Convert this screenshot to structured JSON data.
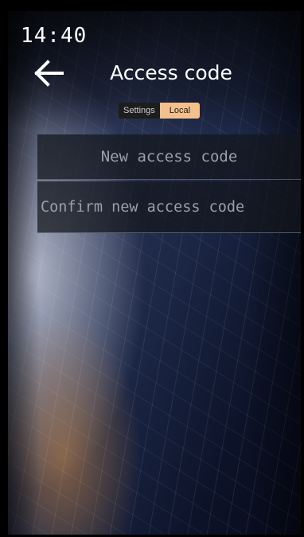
{
  "status_bar": {
    "time": "14:40"
  },
  "header": {
    "title": "Access code",
    "back_icon": "arrow-left-icon"
  },
  "segmented_control": {
    "tabs": [
      {
        "label": "Settings",
        "active": false
      },
      {
        "label": "Local",
        "active": true
      }
    ]
  },
  "form": {
    "new_code": {
      "placeholder": "New access code",
      "value": ""
    },
    "confirm_code": {
      "placeholder": "Confirm new access code",
      "value": ""
    }
  },
  "colors": {
    "accent": "#f4c08c",
    "text": "#ffffff",
    "placeholder": "#9aa0a8"
  }
}
